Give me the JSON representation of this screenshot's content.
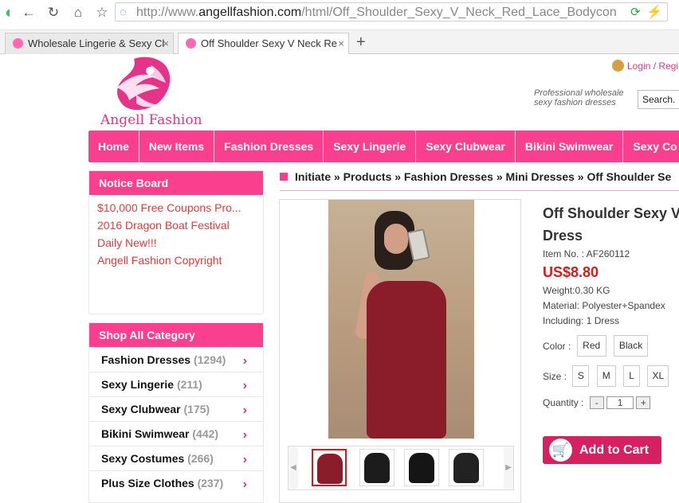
{
  "browser": {
    "url_prefix": "http://www.",
    "url_domain": "angellfashion.com",
    "url_path": "/html/Off_Shoulder_Sexy_V_Neck_Red_Lace_Bodycon",
    "tabs": [
      {
        "label": "Wholesale Lingerie & Sexy Cl"
      },
      {
        "label": "Off Shoulder Sexy V Neck Re"
      }
    ]
  },
  "header": {
    "logo_text": "Angell Fashion",
    "login": "Login / Regi",
    "tagline": "Professional wholesale sexy fashion dresses",
    "search_value": "Search."
  },
  "nav": [
    {
      "label": "Home"
    },
    {
      "label": "New Items"
    },
    {
      "label": "Fashion Dresses"
    },
    {
      "label": "Sexy Lingerie"
    },
    {
      "label": "Sexy Clubwear"
    },
    {
      "label": "Bikini Swimwear"
    },
    {
      "label": "Sexy Co"
    }
  ],
  "notice": {
    "title": "Notice Board",
    "items": [
      "$10,000 Free Coupons Pro...",
      "2016 Dragon Boat Festival",
      "Daily New!!!",
      "Angell Fashion Copyright"
    ]
  },
  "categories": {
    "title": "Shop All Category",
    "items": [
      {
        "name": "Fashion Dresses",
        "count": "(1294)"
      },
      {
        "name": "Sexy Lingerie",
        "count": "(211)"
      },
      {
        "name": "Sexy Clubwear",
        "count": "(175)"
      },
      {
        "name": "Bikini Swimwear",
        "count": "(442)"
      },
      {
        "name": "Sexy Costumes",
        "count": "(266)"
      },
      {
        "name": "Plus Size Clothes",
        "count": "(237)"
      }
    ]
  },
  "breadcrumb": "Initiate » Products » Fashion Dresses » Mini Dresses » Off Shoulder Se",
  "product": {
    "title_line1": "Off Shoulder Sexy V",
    "title_line2": "Dress",
    "item_no": "Item No. : AF260112",
    "price": "US$8.80",
    "weight": "Weight:0.30 KG",
    "material": "Material: Polyester+Spandex",
    "including": "Including: 1 Dress",
    "color_label": "Color :",
    "colors": [
      "Red",
      "Black"
    ],
    "size_label": "Size :",
    "sizes": [
      "S",
      "M",
      "L",
      "XL"
    ],
    "quantity_label": "Quantity :",
    "quantity": "1",
    "add_to_cart": "Add to Cart"
  },
  "thumbnails": [
    {
      "name": "red-front",
      "color": "#8b1d2b"
    },
    {
      "name": "black-front",
      "color": "#1c1c1c"
    },
    {
      "name": "black-front-2",
      "color": "#151515"
    },
    {
      "name": "black-side",
      "color": "#222222"
    }
  ],
  "colors": {
    "brand_pink": "#fb3f8f",
    "price_red": "#d71a1a",
    "cart_button": "#d7205f"
  }
}
